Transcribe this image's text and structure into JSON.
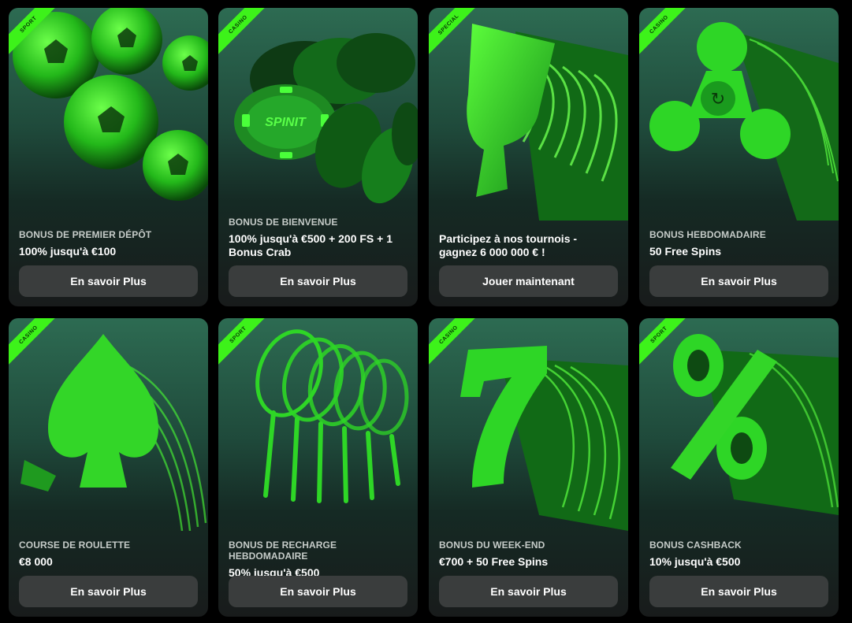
{
  "colors": {
    "accent": "#3df21a",
    "card_top": "#2d6b52",
    "card_bottom": "#181b1b",
    "button": "#3a3d3d"
  },
  "cards": [
    {
      "tag": "SPORT",
      "subtitle": "BONUS DE PREMIER DÉPÔT",
      "title": "100% jusqu'à €100",
      "button": "En savoir Plus",
      "art": "soccer-balls"
    },
    {
      "tag": "CASINO",
      "subtitle": "BONUS DE BIENVENUE",
      "title": "100% jusqu'à €500 + 200 FS + 1 Bonus Crab",
      "button": "En savoir Plus",
      "art": "poker-chips",
      "chip_text": "SPINIT"
    },
    {
      "tag": "SPECIAL",
      "subtitle": "",
      "title": "Participez à nos tournois - gagnez 6 000 000 € !",
      "button": "Jouer maintenant",
      "art": "trophy"
    },
    {
      "tag": "CASINO",
      "subtitle": "BONUS HEBDOMADAIRE",
      "title": "50 Free Spins",
      "button": "En savoir Plus",
      "art": "fidget-spinner"
    },
    {
      "tag": "CASINO",
      "subtitle": "COURSE DE ROULETTE",
      "title": "€8 000",
      "button": "En savoir Plus",
      "art": "spade"
    },
    {
      "tag": "SPORT",
      "subtitle": "BONUS DE RECHARGE HEBDOMADAIRE",
      "title": "50% jusqu'à €500",
      "button": "En savoir Plus",
      "art": "tennis-rackets"
    },
    {
      "tag": "CASINO",
      "subtitle": "BONUS DU WEEK-END",
      "title": "€700 + 50 Free Spins",
      "button": "En savoir Plus",
      "art": "lucky-seven"
    },
    {
      "tag": "SPORT",
      "subtitle": "BONUS CASHBACK",
      "title": "10% jusqu'à €500",
      "button": "En savoir Plus",
      "art": "percent-sign"
    }
  ]
}
